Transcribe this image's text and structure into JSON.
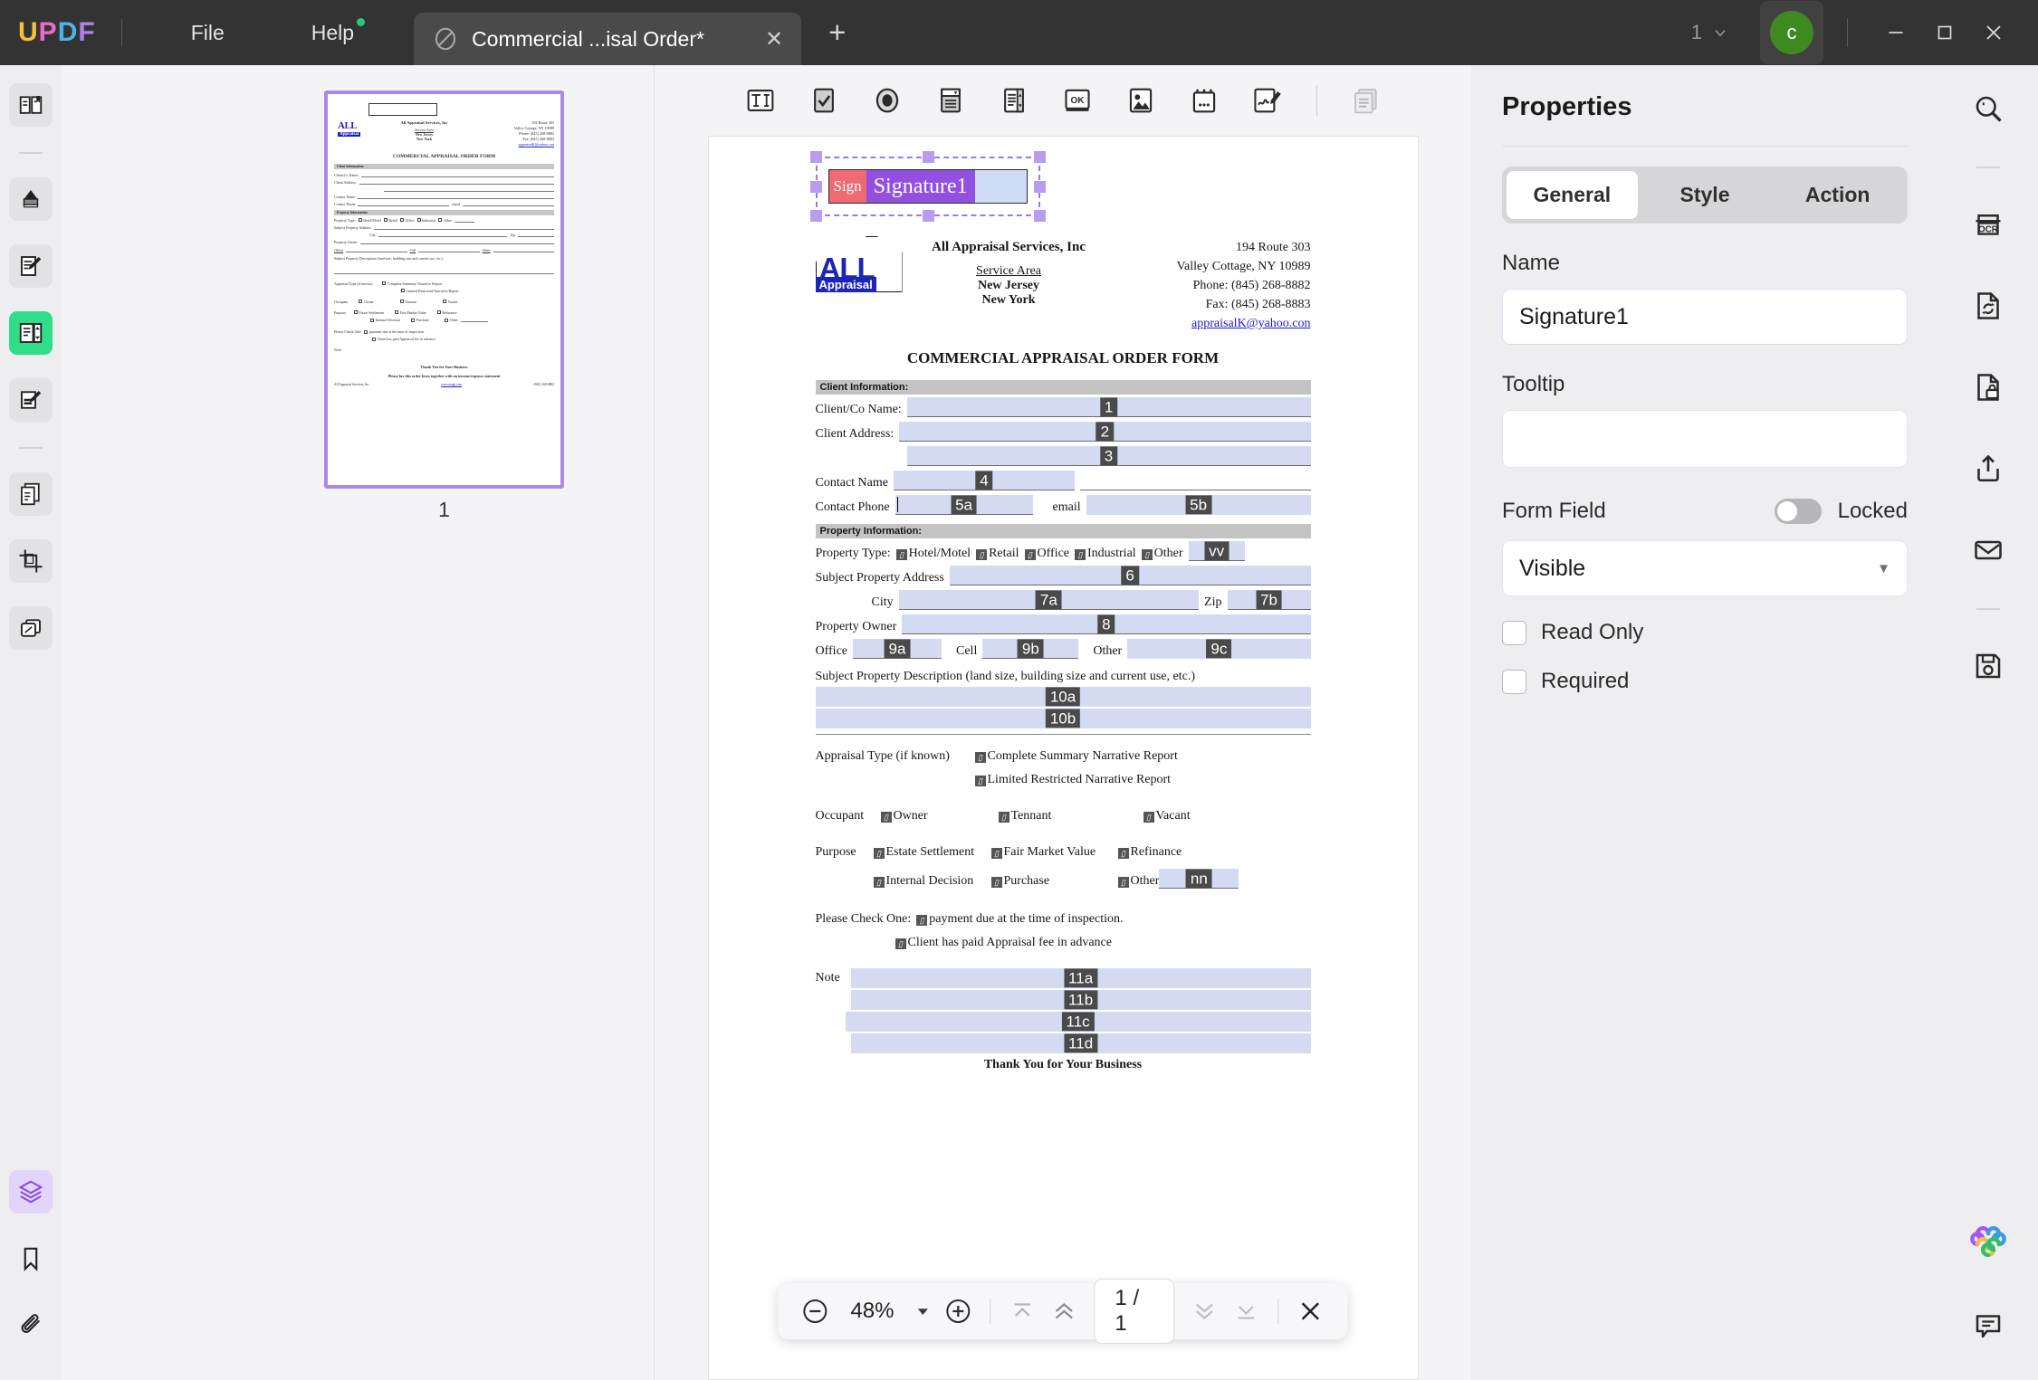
{
  "titlebar": {
    "logo": "UPDF",
    "menus": [
      {
        "label": "File"
      },
      {
        "label": "Help"
      }
    ],
    "tab": {
      "title": "Commercial ...isal Order*",
      "icon": "document-icon",
      "close": "✕"
    },
    "new_tab": "+",
    "window_count": "1",
    "avatar_initial": "c",
    "minimize": "—",
    "maximize": "□",
    "close": "✕"
  },
  "left_rail": {
    "items": [
      {
        "name": "reader-mode",
        "state": "default"
      },
      {
        "name": "annotate-highlight",
        "state": "default"
      },
      {
        "name": "edit-pdf",
        "state": "default"
      },
      {
        "name": "prepare-form",
        "state": "active"
      },
      {
        "name": "fill-and-sign",
        "state": "default"
      },
      {
        "name": "organize-pages",
        "state": "default"
      },
      {
        "name": "crop-pages",
        "state": "default"
      },
      {
        "name": "compare-documents",
        "state": "default"
      }
    ],
    "bottom_items": [
      {
        "name": "layers",
        "state": "active"
      },
      {
        "name": "bookmarks",
        "state": "default"
      },
      {
        "name": "attachments",
        "state": "default"
      }
    ]
  },
  "thumbnails": {
    "page_number": "1"
  },
  "form_toolbar": {
    "tools": [
      {
        "name": "text-field-tool",
        "label": "Text Field"
      },
      {
        "name": "checkbox-tool",
        "label": "Check Box"
      },
      {
        "name": "radio-button-tool",
        "label": "Radio Button"
      },
      {
        "name": "combo-box-tool",
        "label": "Combo Box"
      },
      {
        "name": "list-box-tool",
        "label": "List Box"
      },
      {
        "name": "push-button-tool",
        "label": "Push Button"
      },
      {
        "name": "image-field-tool",
        "label": "Image Field"
      },
      {
        "name": "date-field-tool",
        "label": "Date Field"
      },
      {
        "name": "signature-field-tool",
        "label": "Digital Signature"
      },
      {
        "name": "page-properties-tool",
        "label": "Page"
      }
    ]
  },
  "document": {
    "signature_widget": {
      "prefix": "Sign",
      "name": "Signature1"
    },
    "company": "All Appraisal Services, Inc",
    "service_area_label": "Service Area",
    "service_areas": [
      "New Jersey",
      "New York"
    ],
    "address_lines": [
      "194 Route 303",
      "Valley Cottage, NY 10989",
      "Phone:  (845) 268-8882",
      "Fax:  (845) 268-8883"
    ],
    "email": "appraisalK@yahoo.con",
    "logo_text": "ALL",
    "logo_badge": "Appraisal",
    "title": "COMMERCIAL APPRAISAL ORDER FORM",
    "client_band": "Client Information:",
    "client_rows": [
      {
        "label": "Client/Co Name:",
        "badge": "1"
      },
      {
        "label": "Client Address:",
        "badge": "2"
      },
      {
        "label": "",
        "badge": "3"
      },
      {
        "label": "Contact Name",
        "badge": "4"
      }
    ],
    "contact_phone_label": "Contact Phone",
    "contact_phone_badge": "5a",
    "email_label": "email",
    "email_badge": "5b",
    "property_band": "Property Information:",
    "property_type_label": "Property Type:",
    "property_types": [
      "Hotel/Motel",
      "Retail",
      "Office",
      "Industrial",
      "Other"
    ],
    "property_other_badge": "vv",
    "subject_address_label": "Subject Property Address",
    "subject_address_badge": "6",
    "city_label": "City",
    "city_badge": "7a",
    "zip_label": "Zip",
    "zip_badge": "7b",
    "owner_label": "Property Owner",
    "owner_badge": "8",
    "phone_office_label": "Office",
    "phone_office_badge": "9a",
    "phone_cell_label": "Cell",
    "phone_cell_badge": "9b",
    "phone_other_label": "Other",
    "phone_other_badge": "9c",
    "description_label": "Subject Property Description (land size, building size and current use, etc.)",
    "description_badges": [
      "10a",
      "10b"
    ],
    "appraisal_type_label": "Appraisal Type (if known)",
    "appraisal_types": [
      "Complete Summary Narrative Report",
      "Limited Restricted Narrative Report"
    ],
    "occupant_label": "Occupant",
    "occupants": [
      "Owner",
      "Tennant",
      "Vacant"
    ],
    "purpose_label": "Purpose",
    "purposes_row1": [
      "Estate Settlement",
      "Fair Market Value",
      "Refinance"
    ],
    "purposes_row2": [
      "Internal Decision",
      "Purchase",
      "Other"
    ],
    "purpose_other_badge": "nn",
    "check_one_label": "Please Check One:",
    "check_one_text": "payment due at the time of inspection.",
    "check_two_text": "Client has paid Appraisal fee in advance",
    "note_label": "Note",
    "note_badges": [
      "11a",
      "11b",
      "11c",
      "11d"
    ],
    "thanks": "Thank You for Your Business"
  },
  "bottom_bar": {
    "zoom_out": "−",
    "zoom_level": "48%",
    "zoom_dropdown": "▼",
    "zoom_in": "+",
    "first_page": "first-page-icon",
    "prev_page": "prev-page-icon",
    "page_indicator": "1 / 1",
    "next_page": "next-page-icon",
    "last_page": "last-page-icon",
    "close": "✕"
  },
  "properties": {
    "title": "Properties",
    "tabs": [
      {
        "label": "General",
        "active": true
      },
      {
        "label": "Style",
        "active": false
      },
      {
        "label": "Action",
        "active": false
      }
    ],
    "name_label": "Name",
    "name_value": "Signature1",
    "tooltip_label": "Tooltip",
    "tooltip_value": "",
    "form_field_label": "Form Field",
    "locked_label": "Locked",
    "locked_on": false,
    "visibility_value": "Visible",
    "visibility_arrow": "▼",
    "read_only_label": "Read Only",
    "read_only_checked": false,
    "required_label": "Required",
    "required_checked": false
  },
  "right_rail": {
    "items": [
      {
        "name": "search-icon"
      },
      {
        "name": "ocr-icon"
      },
      {
        "name": "convert-pdf-icon"
      },
      {
        "name": "protect-pdf-icon"
      },
      {
        "name": "share-icon"
      },
      {
        "name": "email-icon"
      },
      {
        "name": "save-as-icon"
      }
    ],
    "bottom_items": [
      {
        "name": "ai-assistant-icon"
      },
      {
        "name": "comment-icon"
      }
    ]
  },
  "colors": {
    "accent_purple": "#9350e0",
    "active_green": "#2fdd8a",
    "field_fill": "#d5daf3",
    "badge": "#4a4a4a",
    "avatar_green": "#3d8a21",
    "logo_blue": "#1c25b5"
  }
}
